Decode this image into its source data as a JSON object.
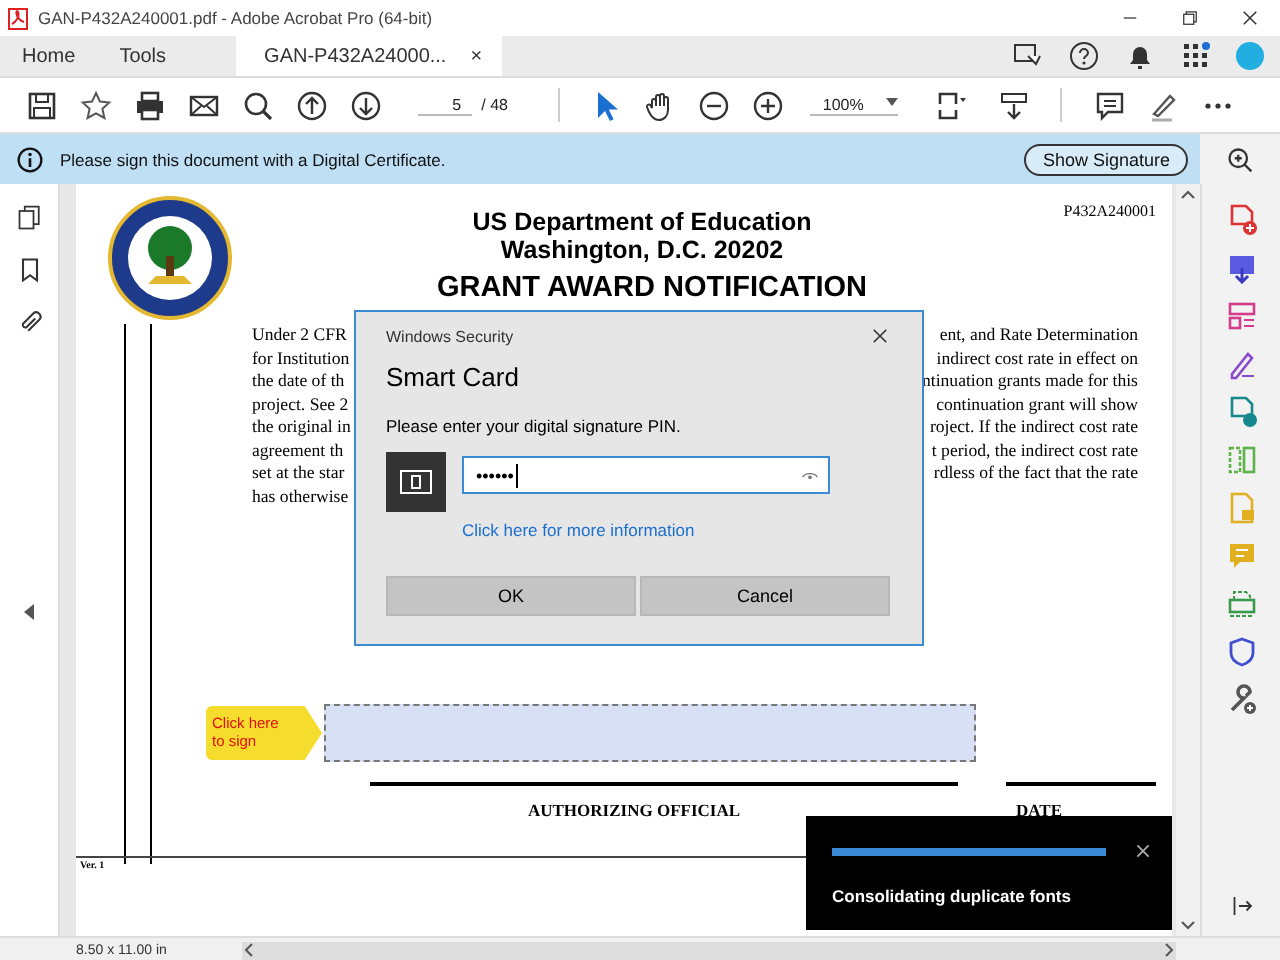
{
  "window": {
    "title": "GAN-P432A240001.pdf - Adobe Acrobat Pro (64-bit)"
  },
  "tabs": [
    {
      "label": "Home",
      "selected": false
    },
    {
      "label": "Tools",
      "selected": false
    },
    {
      "label": "GAN-P432A24000...",
      "selected": true,
      "close": "×"
    }
  ],
  "toolbar": {
    "page": "5",
    "page_total": "/ 48",
    "zoom": "100%"
  },
  "info_bar": {
    "message": "Please sign this document with a Digital Certificate.",
    "button": "Show Signature"
  },
  "document": {
    "number": "P432A240001",
    "header": [
      "US Department of Education",
      "Washington, D.C. 20202"
    ],
    "title": "GRANT AWARD NOTIFICATION",
    "body_lines": [
      {
        "left": "Under 2 CFR",
        "right": "ent, and Rate Determination"
      },
      {
        "left": "for Institution",
        "right": "indirect cost rate in effect on"
      },
      {
        "left": "the date of th",
        "right": "ntinuation grants made for this"
      },
      {
        "left": "project. See 2",
        "right": "continuation grant will show"
      },
      {
        "left": "the original in",
        "right": "roject. If the indirect cost rate"
      },
      {
        "left": "agreement th",
        "right": "t period, the indirect cost rate"
      },
      {
        "left": "set at the star",
        "right": "rdless of the fact that the rate"
      },
      {
        "left": "has otherwise"
      }
    ],
    "sign_tag": "Click here to sign",
    "signer_label": "AUTHORIZING OFFICIAL",
    "date_label": "DATE",
    "version": "Ver. 1"
  },
  "dialog": {
    "caption": "Windows Security",
    "title": "Smart Card",
    "prompt": "Please enter your digital signature PIN.",
    "pin": "••••••",
    "link": "Click here for more information",
    "buttons": [
      "OK",
      "Cancel"
    ]
  },
  "toast": {
    "level": 1,
    "message": "Consolidating duplicate fonts"
  },
  "status_bar": {
    "page_size": "8.50 x 11.00 in"
  }
}
